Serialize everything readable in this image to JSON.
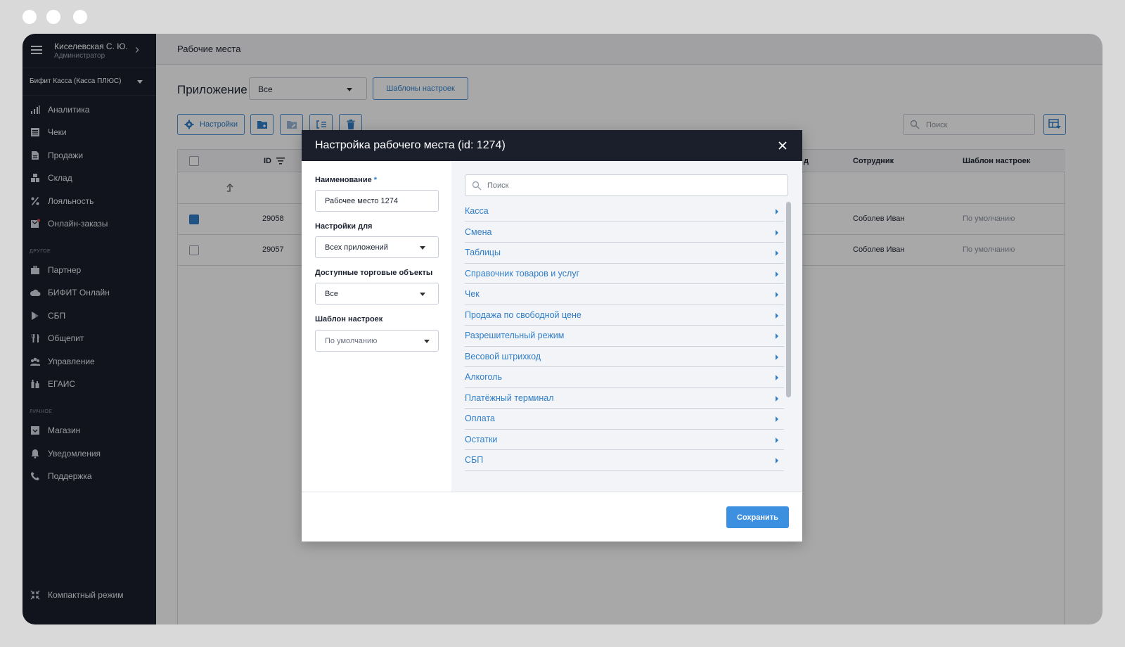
{
  "user": {
    "name": "Киселевская С. Ю.",
    "role": "Администратор"
  },
  "app_selector": {
    "value": "Бифит Касса (Касса ПЛЮС)"
  },
  "sidebar": {
    "items": [
      {
        "label": "Аналитика",
        "icon": "analytics-icon"
      },
      {
        "label": "Чеки",
        "icon": "receipt-icon"
      },
      {
        "label": "Продажи",
        "icon": "document-icon"
      },
      {
        "label": "Склад",
        "icon": "boxes-icon"
      },
      {
        "label": "Лояльность",
        "icon": "percent-icon"
      },
      {
        "label": "Онлайн-заказы",
        "icon": "online-orders-icon"
      }
    ],
    "section_other": "ДРУГОЕ",
    "other_items": [
      {
        "label": "Партнер",
        "icon": "briefcase-icon"
      },
      {
        "label": "БИФИТ Онлайн",
        "icon": "cloud-icon"
      },
      {
        "label": "СБП",
        "icon": "sbp-icon"
      },
      {
        "label": "Общепит",
        "icon": "cutlery-icon"
      },
      {
        "label": "Управление",
        "icon": "people-icon"
      },
      {
        "label": "ЕГАИС",
        "icon": "bottles-icon"
      }
    ],
    "section_personal": "ЛИЧНОЕ",
    "personal_items": [
      {
        "label": "Магазин",
        "icon": "store-icon"
      },
      {
        "label": "Уведомления",
        "icon": "bell-icon"
      },
      {
        "label": "Поддержка",
        "icon": "phone-icon"
      }
    ],
    "compact_label": "Компактный режим"
  },
  "page": {
    "title": "Рабочие места",
    "app_label": "Приложение",
    "app_filter_value": "Все",
    "templates_button": "Шаблоны настроек",
    "settings_button": "Настройки",
    "search_placeholder": "Поиск"
  },
  "table": {
    "headers": {
      "id": "ID",
      "employee": "Сотрудник",
      "template": "Шаблон настроек",
      "partial_header": "д"
    },
    "rows": [
      {
        "id": "29058",
        "checked": true,
        "employee": "Соболев Иван",
        "template": "По умолчанию"
      },
      {
        "id": "29057",
        "checked": false,
        "employee": "Соболев Иван",
        "template": "По умолчанию"
      }
    ]
  },
  "modal": {
    "title": "Настройка рабочего места (id: 1274)",
    "name_label": "Наименование",
    "required_mark": "*",
    "name_value": "Рабочее место 1274",
    "settings_for_label": "Настройки для",
    "settings_for_value": "Всех приложений",
    "objects_label": "Доступные торговые объекты",
    "objects_value": "Все",
    "template_label": "Шаблон настроек",
    "template_value": "По умолчанию",
    "search_placeholder": "Поиск",
    "categories": [
      "Касса",
      "Смена",
      "Таблицы",
      "Справочник товаров и услуг",
      "Чек",
      "Продажа по свободной цене",
      "Разрешительный режим",
      "Весовой штрихкод",
      "Алкоголь",
      "Платёжный терминал",
      "Оплата",
      "Остатки",
      "СБП"
    ],
    "save_button": "Сохранить"
  },
  "colors": {
    "sidebar_bg": "#1b1f2c",
    "accent": "#2f7ec9",
    "save": "#3d8fe0"
  }
}
